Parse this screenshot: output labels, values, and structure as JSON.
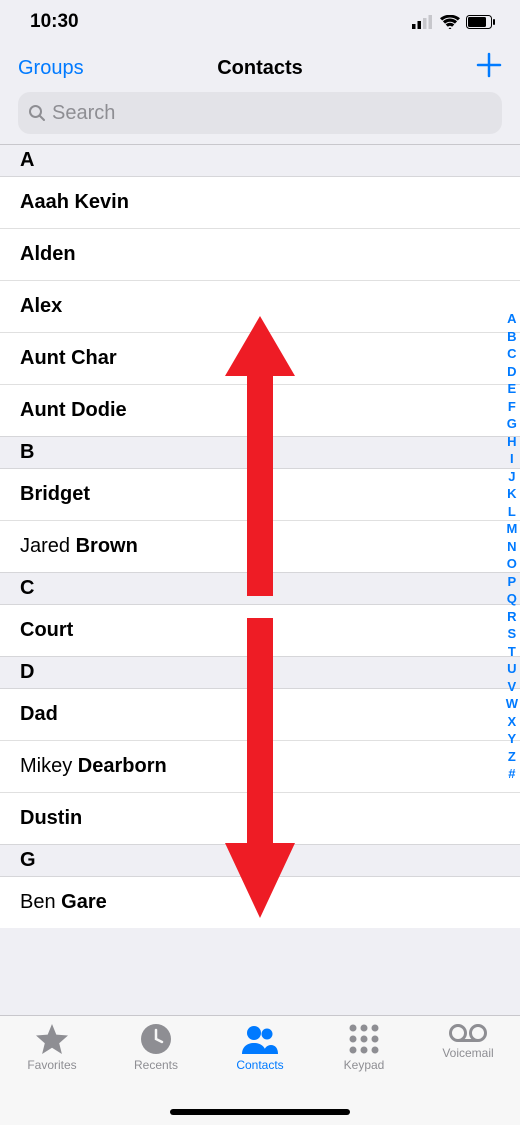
{
  "status": {
    "time": "10:30"
  },
  "nav": {
    "groups": "Groups",
    "title": "Contacts"
  },
  "search": {
    "placeholder": "Search"
  },
  "index": [
    "A",
    "B",
    "C",
    "D",
    "E",
    "F",
    "G",
    "H",
    "I",
    "J",
    "K",
    "L",
    "M",
    "N",
    "O",
    "P",
    "Q",
    "R",
    "S",
    "T",
    "U",
    "V",
    "W",
    "X",
    "Y",
    "Z",
    "#"
  ],
  "sections": [
    {
      "letter": "A",
      "rows": [
        {
          "display": "Aaah Kevin",
          "bold": "Aaah Kevin"
        },
        {
          "display": "Alden",
          "bold": "Alden"
        },
        {
          "display": "Alex",
          "bold": "Alex"
        },
        {
          "display": "Aunt Char",
          "bold": "Aunt Char"
        },
        {
          "display": "Aunt Dodie",
          "bold": "Aunt Dodie"
        }
      ]
    },
    {
      "letter": "B",
      "rows": [
        {
          "display": "Bridget",
          "bold": "Bridget"
        },
        {
          "first": "Jared ",
          "bold": "Brown"
        }
      ]
    },
    {
      "letter": "C",
      "rows": [
        {
          "display": "Court",
          "bold": "Court"
        }
      ]
    },
    {
      "letter": "D",
      "rows": [
        {
          "display": "Dad",
          "bold": "Dad"
        },
        {
          "first": "Mikey ",
          "bold": "Dearborn"
        },
        {
          "display": "Dustin",
          "bold": "Dustin"
        }
      ]
    },
    {
      "letter": "G",
      "rows": [
        {
          "first": "Ben ",
          "bold": "Gare"
        }
      ]
    }
  ],
  "tabs": {
    "favorites": "Favorites",
    "recents": "Recents",
    "contacts": "Contacts",
    "keypad": "Keypad",
    "voicemail": "Voicemail"
  }
}
